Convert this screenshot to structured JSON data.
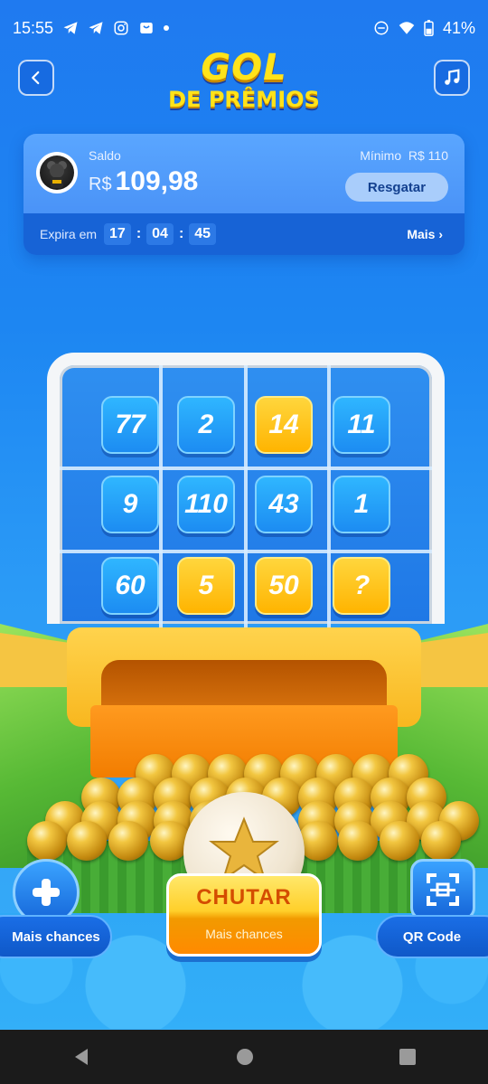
{
  "status_bar": {
    "time": "15:55",
    "battery": "41%",
    "left_icons": [
      "telegram-icon",
      "telegram-icon",
      "instagram-icon",
      "shopping-bag-icon",
      "notification-dot-icon"
    ],
    "right_icons": [
      "do-not-disturb-icon",
      "wifi-icon",
      "battery-icon"
    ]
  },
  "header": {
    "title_line1": "GOL",
    "title_line2": "DE PRÊMIOS",
    "back_icon": "chevron-left-icon",
    "music_icon": "music-note-icon"
  },
  "balance_card": {
    "saldo_label": "Saldo",
    "currency": "R$",
    "amount": "109,98",
    "minimo_label": "Mínimo",
    "minimo_value": "R$ 110",
    "redeem_button": "Resgatar",
    "expira_label": "Expira em",
    "timer": {
      "hours": "17",
      "minutes": "04",
      "seconds": "45"
    },
    "more_link": "Mais"
  },
  "goal_grid": [
    [
      {
        "value": "77",
        "style": "blue"
      },
      {
        "value": "2",
        "style": "blue"
      },
      {
        "value": "14",
        "style": "gold"
      },
      {
        "value": "11",
        "style": "blue"
      }
    ],
    [
      {
        "value": "9",
        "style": "blue"
      },
      {
        "value": "110",
        "style": "blue"
      },
      {
        "value": "43",
        "style": "blue"
      },
      {
        "value": "1",
        "style": "blue"
      }
    ],
    [
      {
        "value": "60",
        "style": "blue"
      },
      {
        "value": "5",
        "style": "gold"
      },
      {
        "value": "50",
        "style": "gold"
      },
      {
        "value": "?",
        "style": "gold"
      }
    ]
  ],
  "actions": {
    "kick_button": "CHUTAR",
    "kick_sub": "Mais chances",
    "more_chances_button": "Mais chances",
    "qr_button": "QR Code"
  },
  "nav_bar": {
    "icons": [
      "back-triangle-icon",
      "home-circle-icon",
      "recents-square-icon"
    ]
  },
  "colors": {
    "background_blue": "#1f7af0",
    "gold": "#ffcf2a",
    "title_yellow": "#ffe31a",
    "kick_text": "#d44d00"
  }
}
